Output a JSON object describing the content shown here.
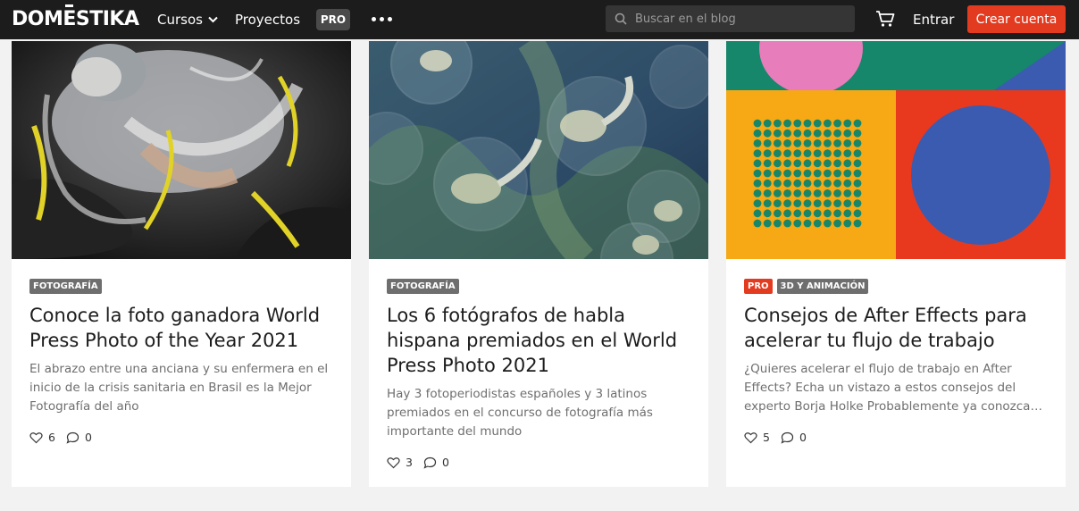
{
  "header": {
    "logo": "DOMESTIKA",
    "nav": {
      "cursos": "Cursos",
      "proyectos": "Proyectos",
      "pro": "PRO"
    },
    "search_placeholder": "Buscar en el blog",
    "login": "Entrar",
    "signup": "Crear cuenta",
    "icons": [
      "chevron-down-icon",
      "more-dots-icon",
      "search-icon",
      "cart-icon"
    ]
  },
  "cards": [
    {
      "tags": [
        "FOTOGRAFÍA"
      ],
      "title": "Conoce la foto ganadora World Press Photo of the Year 2021",
      "description": "El abrazo entre una anciana y su enfermera en el inicio de la crisis sanitaria en Brasil es la Mejor Fotografía del año",
      "likes": "6",
      "comments": "0"
    },
    {
      "tags": [
        "FOTOGRAFÍA"
      ],
      "title": "Los 6 fotógrafos de habla hispana premiados en el World Press Photo 2021",
      "description": "Hay 3 fotoperiodistas españoles y 3 latinos premiados en el concurso de fotografía más importante del mundo",
      "likes": "3",
      "comments": "0"
    },
    {
      "tags": [
        "PRO",
        "3D Y ANIMACIÓN"
      ],
      "title": "Consejos de After Effects para acelerar tu flujo de trabajo",
      "description": "¿Quieres acelerar el flujo de trabajo en After Effects? Echa un vistazo a estos consejos del experto Borja Holke Probablemente ya conozcas algunos de estos atajos",
      "likes": "5",
      "comments": "0"
    }
  ],
  "colors": {
    "header_bg": "#1c1c1c",
    "accent": "#e33b20",
    "page_bg": "#f2f2f2",
    "tag_bg": "#6e6e6e"
  }
}
